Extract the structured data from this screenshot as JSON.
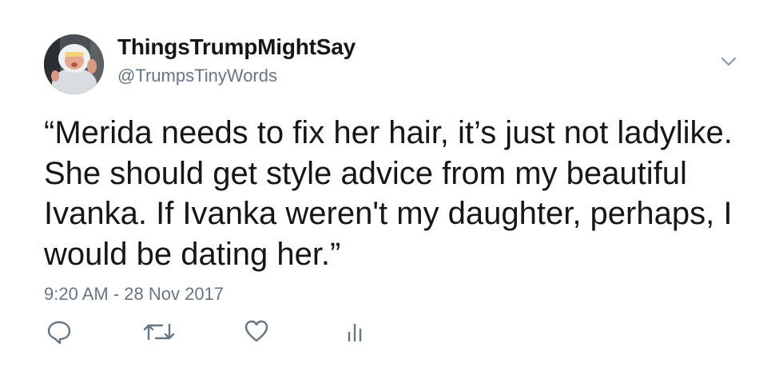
{
  "tweet": {
    "display_name": "ThingsTrumpMightSay",
    "handle": "@TrumpsTinyWords",
    "text": "“Merida needs to fix her hair, it’s just not ladylike. She should get style advice from my beautiful Ivanka. If Ivanka weren't my daughter, perhaps, I would be dating her.”",
    "timestamp": "9:20 AM - 28 Nov 2017"
  },
  "icons": {
    "avatar": "profile-avatar",
    "menu": "chevron-down-icon",
    "reply": "reply-icon",
    "retweet": "retweet-icon",
    "like": "heart-icon",
    "analytics": "analytics-icon"
  },
  "colors": {
    "text_primary": "#14171a",
    "text_secondary": "#657786",
    "background": "#ffffff"
  }
}
